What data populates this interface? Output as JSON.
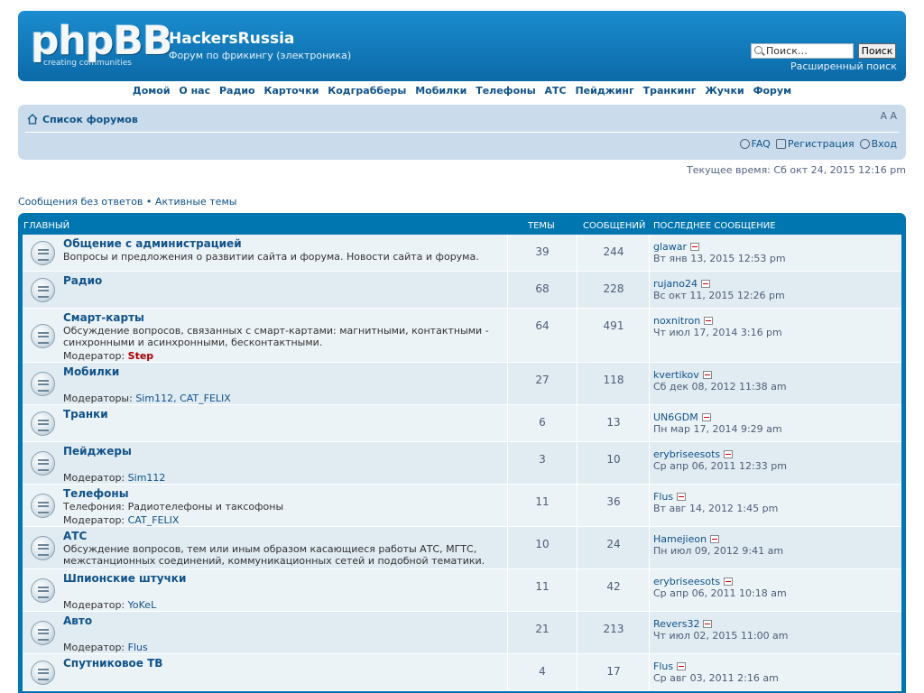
{
  "header": {
    "logo_text": "phpBB",
    "logo_tagline": "creating   communities",
    "site_title": "HackersRussia",
    "site_description": "Форум по фрикингу (электроника)",
    "search_placeholder": "Поиск…",
    "search_button": "Поиск",
    "advanced_search": "Расширенный поиск"
  },
  "topnav": [
    "Домой",
    "О нас",
    "Радио",
    "Карточки",
    "Кодграбберы",
    "Мобилки",
    "Телефоны",
    "АТС",
    "Пейджинг",
    "Транкинг",
    "Жучки",
    "Форум"
  ],
  "navbar": {
    "breadcrumb": "Список форумов",
    "font_size_control": "A A",
    "faq": "FAQ",
    "register": "Регистрация",
    "login": "Вход"
  },
  "current_time": "Текущее время: Сб окт 24, 2015 12:16 pm",
  "search_links": {
    "unanswered": "Сообщения без ответов",
    "separator": "•",
    "active": "Активные темы"
  },
  "forum_table": {
    "headers": {
      "category": "ГЛАВНЫЙ",
      "topics": "ТЕМЫ",
      "posts": "СООБЩЕНИЙ",
      "last_post": "ПОСЛЕДНЕЕ СООБЩЕНИЕ"
    },
    "rows": [
      {
        "title": "Общение с администрацией",
        "desc": "Вопросы и предложения о развитии сайта и форума. Новости сайта и форума.",
        "mod_label": "",
        "mods": "",
        "topics": "39",
        "posts": "244",
        "last_user": "glawar",
        "last_date": "Вт янв 13, 2015 12:53 pm"
      },
      {
        "title": "Радио",
        "desc": "",
        "mod_label": "",
        "mods": "",
        "topics": "68",
        "posts": "228",
        "last_user": "rujano24",
        "last_date": "Вс окт 11, 2015 12:26 pm"
      },
      {
        "title": "Смарт-карты",
        "desc": "Обсуждение вопросов, связанных с смарт-картами: магнитными, контактными - синхронными и асинхронными, бесконтактными.",
        "mod_label": "Модератор:",
        "mods": "Step",
        "topics": "64",
        "posts": "491",
        "last_user": "noxnitron",
        "last_date": "Чт июл 17, 2014 3:16 pm"
      },
      {
        "title": "Мобилки",
        "desc": "",
        "mod_label": "Модераторы:",
        "mods": "Sim112, CAT_FELIX",
        "topics": "27",
        "posts": "118",
        "last_user": "kvertikov",
        "last_date": "Сб дек 08, 2012 11:38 am"
      },
      {
        "title": "Транки",
        "desc": "",
        "mod_label": "",
        "mods": "",
        "topics": "6",
        "posts": "13",
        "last_user": "UN6GDM",
        "last_date": "Пн мар 17, 2014 9:29 am"
      },
      {
        "title": "Пейджеры",
        "desc": "",
        "mod_label": "Модератор:",
        "mods": "Sim112",
        "topics": "3",
        "posts": "10",
        "last_user": "erybriseesots",
        "last_date": "Ср апр 06, 2011 12:33 pm"
      },
      {
        "title": "Телефоны",
        "desc": "Телефония: Радиотелефоны и таксофоны",
        "mod_label": "Модератор:",
        "mods": "CAT_FELIX",
        "topics": "11",
        "posts": "36",
        "last_user": "Flus",
        "last_date": "Вт авг 14, 2012 1:45 pm"
      },
      {
        "title": "АТС",
        "desc": "Обсуждение вопросов, тем или иным образом касающиеся работы АТС, МГТС, межстанционных соединений, коммуникационных сетей и подобной тематики.",
        "mod_label": "",
        "mods": "",
        "topics": "10",
        "posts": "24",
        "last_user": "Hamejieon",
        "last_date": "Пн июл 09, 2012 9:41 am"
      },
      {
        "title": "Шпионские штучки",
        "desc": "",
        "mod_label": "Модератор:",
        "mods": "YoKeL",
        "topics": "11",
        "posts": "42",
        "last_user": "erybriseesots",
        "last_date": "Ср апр 06, 2011 10:18 am"
      },
      {
        "title": "Авто",
        "desc": "",
        "mod_label": "Модератор:",
        "mods": "Flus",
        "topics": "21",
        "posts": "213",
        "last_user": "Revers32",
        "last_date": "Чт июл 02, 2015 11:00 am"
      },
      {
        "title": "Спутниковое ТВ",
        "desc": "",
        "mod_label": "",
        "mods": "",
        "topics": "4",
        "posts": "17",
        "last_user": "Flus",
        "last_date": "Ср авг 03, 2011 2:16 am"
      }
    ]
  }
}
